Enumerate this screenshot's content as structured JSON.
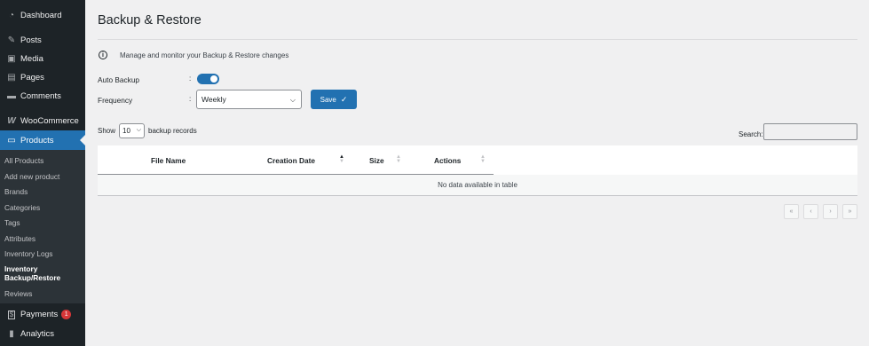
{
  "sidebar": {
    "items": [
      {
        "label": "Dashboard",
        "icon": "dashboard-icon"
      },
      {
        "label": "Posts",
        "icon": "pin-icon"
      },
      {
        "label": "Media",
        "icon": "media-icon"
      },
      {
        "label": "Pages",
        "icon": "pages-icon"
      },
      {
        "label": "Comments",
        "icon": "comments-icon"
      },
      {
        "label": "WooCommerce",
        "icon": "woocommerce-icon"
      },
      {
        "label": "Products",
        "icon": "products-icon"
      },
      {
        "label": "Payments",
        "icon": "payments-icon",
        "badge": "1"
      },
      {
        "label": "Analytics",
        "icon": "analytics-icon"
      }
    ],
    "submenu": [
      "All Products",
      "Add new product",
      "Brands",
      "Categories",
      "Tags",
      "Attributes",
      "Inventory Logs",
      "Inventory Backup/Restore",
      "Reviews"
    ]
  },
  "page": {
    "title": "Backup & Restore",
    "info_text": "Manage and monitor your Backup & Restore changes",
    "auto_backup_label": "Auto Backup",
    "auto_backup_enabled": true,
    "frequency_label": "Frequency",
    "colon": ":",
    "frequency_value": "Weekly",
    "save_label": "Save"
  },
  "table": {
    "show_label": "Show",
    "page_length": "10",
    "records_label": "backup records",
    "search_label": "Search:",
    "columns": [
      "File Name",
      "Creation Date",
      "Size",
      "Actions"
    ],
    "empty_text": "No data available in table",
    "pager": [
      "«",
      "‹",
      "›",
      "»"
    ]
  },
  "colors": {
    "sidebar_bg": "#1d2327",
    "accent": "#2271b1",
    "page_bg": "#f0f0f1",
    "badge": "#d63638"
  }
}
